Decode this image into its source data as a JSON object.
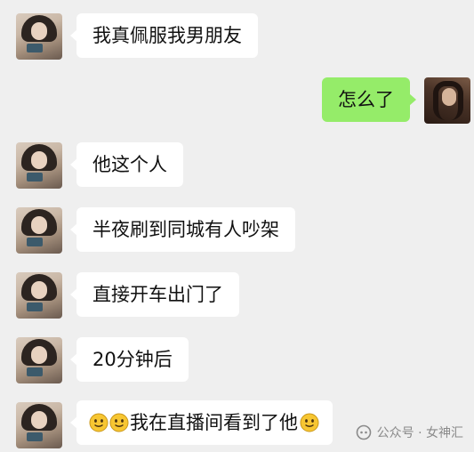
{
  "messages": [
    {
      "side": "left",
      "text": "我真佩服我男朋友"
    },
    {
      "side": "right",
      "text": "怎么了"
    },
    {
      "side": "left",
      "text": "他这个人"
    },
    {
      "side": "left",
      "text": "半夜刷到同城有人吵架"
    },
    {
      "side": "left",
      "text": "直接开车出门了"
    },
    {
      "side": "left",
      "text": "20分钟后"
    },
    {
      "side": "left",
      "text": "我在直播间看到了他",
      "emoji_before": [
        "smile-emoji",
        "smile-emoji"
      ],
      "emoji_after": [
        "smile-emoji"
      ]
    }
  ],
  "watermark": {
    "text": "公众号 · 女神汇",
    "icon": "wechat-official-account-icon"
  },
  "colors": {
    "background": "#efefef",
    "bubble_left": "#ffffff",
    "bubble_right": "#95ec69",
    "emoji_face": "#f7c632"
  }
}
